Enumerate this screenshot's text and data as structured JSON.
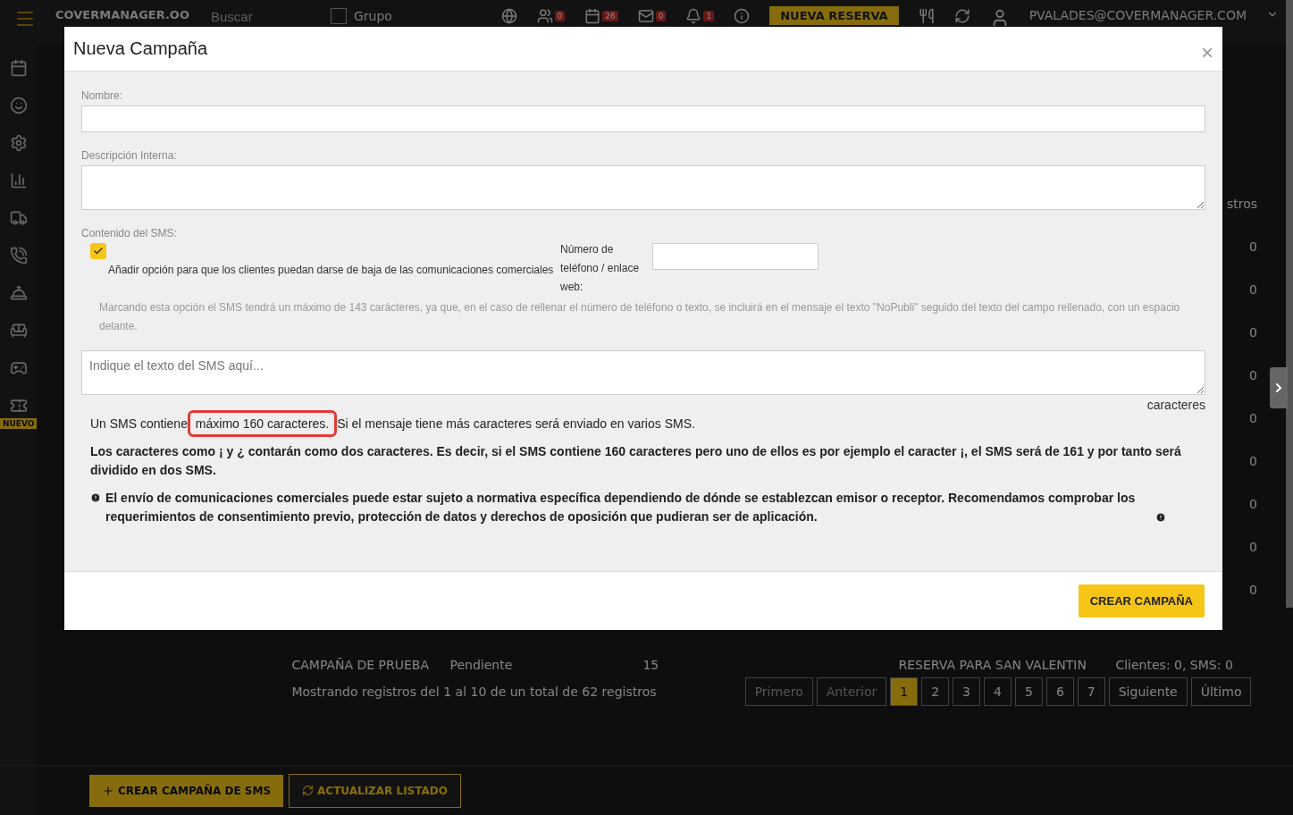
{
  "topbar": {
    "brand": "COVERMANAGER.OO",
    "search_placeholder": "Buscar",
    "group": {
      "label": "Grupo",
      "checked": false
    },
    "badges": [
      "0",
      "26",
      "0",
      "1"
    ],
    "new_booking": "NUEVA RESERVA",
    "user": "PVALADES@COVERMANAGER.COM"
  },
  "sidebar": {
    "new_badge": "NUEVO"
  },
  "background": {
    "header_fragment": "stros",
    "column_fragments": [
      "0",
      "0",
      "0",
      "0",
      "0",
      "0",
      "0",
      "0",
      "0"
    ],
    "row": [
      "CAMPAÑA DE PRUEBA",
      "Pendiente",
      "15",
      "RESERVA PARA SAN VALENTIN",
      "Clientes: 0, SMS: 0"
    ],
    "summary": "Mostrando registros del 1 al 10 de un total de 62 registros",
    "pagination": [
      {
        "label": "Primero",
        "selected": false,
        "disabled": true
      },
      {
        "label": "Anterior",
        "selected": false,
        "disabled": true
      },
      {
        "label": "1",
        "selected": true,
        "disabled": false
      },
      {
        "label": "2",
        "selected": false,
        "disabled": false
      },
      {
        "label": "3",
        "selected": false,
        "disabled": false
      },
      {
        "label": "4",
        "selected": false,
        "disabled": false
      },
      {
        "label": "5",
        "selected": false,
        "disabled": false
      },
      {
        "label": "6",
        "selected": false,
        "disabled": false
      },
      {
        "label": "7",
        "selected": false,
        "disabled": false
      },
      {
        "label": "Siguiente",
        "selected": false,
        "disabled": false
      },
      {
        "label": "Último",
        "selected": false,
        "disabled": false
      }
    ],
    "create_button": "CREAR CAMPAÑA DE SMS",
    "refresh_button": "ACTUALIZAR LISTADO"
  },
  "modal": {
    "title": "Nueva Campaña",
    "close": "×",
    "name_label": "Nombre:",
    "description_label": "Descripción Interna:",
    "content_label": "Contenido del SMS:",
    "optout": {
      "checked": true,
      "label": "Añadir opción para que los clientes puedan darse de baja de las comunicaciones comerciales"
    },
    "phone_label": "Número de teléfono / enlace web:",
    "optout_hint": "Marcando esta opción el SMS tendrá un máximo de 143 carácteres, ya que, en el caso de rellenar el número de teléfono o texto, se incluirá en el mensaje el texto \"NoPubli\" seguido del texto del campo rellenado, con un espacio delante.",
    "sms_placeholder": "Indique el texto del SMS aquí...",
    "counter": "caracteres",
    "note": {
      "before": "Un SMS contiene",
      "highlighted": "máximo 160 caracteres.",
      "after": "Si el mensaje tiene más caracteres será enviado en varios SMS."
    },
    "chars_note": "Los caracteres como ¡ y ¿ contarán como dos caracteres. Es decir, si el SMS contiene 160 caracteres pero uno de ellos es por ejemplo el caracter ¡, el SMS será de 161 y por tanto será dividido en dos SMS.",
    "legal_note": "El envío de comunicaciones comerciales puede estar sujeto a normativa específica dependiendo de dónde se establezcan emisor o receptor. Recomendamos comprobar los requerimientos de consentimiento previo, protección de datos y derechos de oposición que pudieran ser de aplicación.",
    "submit": "CREAR CAMPAÑA"
  }
}
